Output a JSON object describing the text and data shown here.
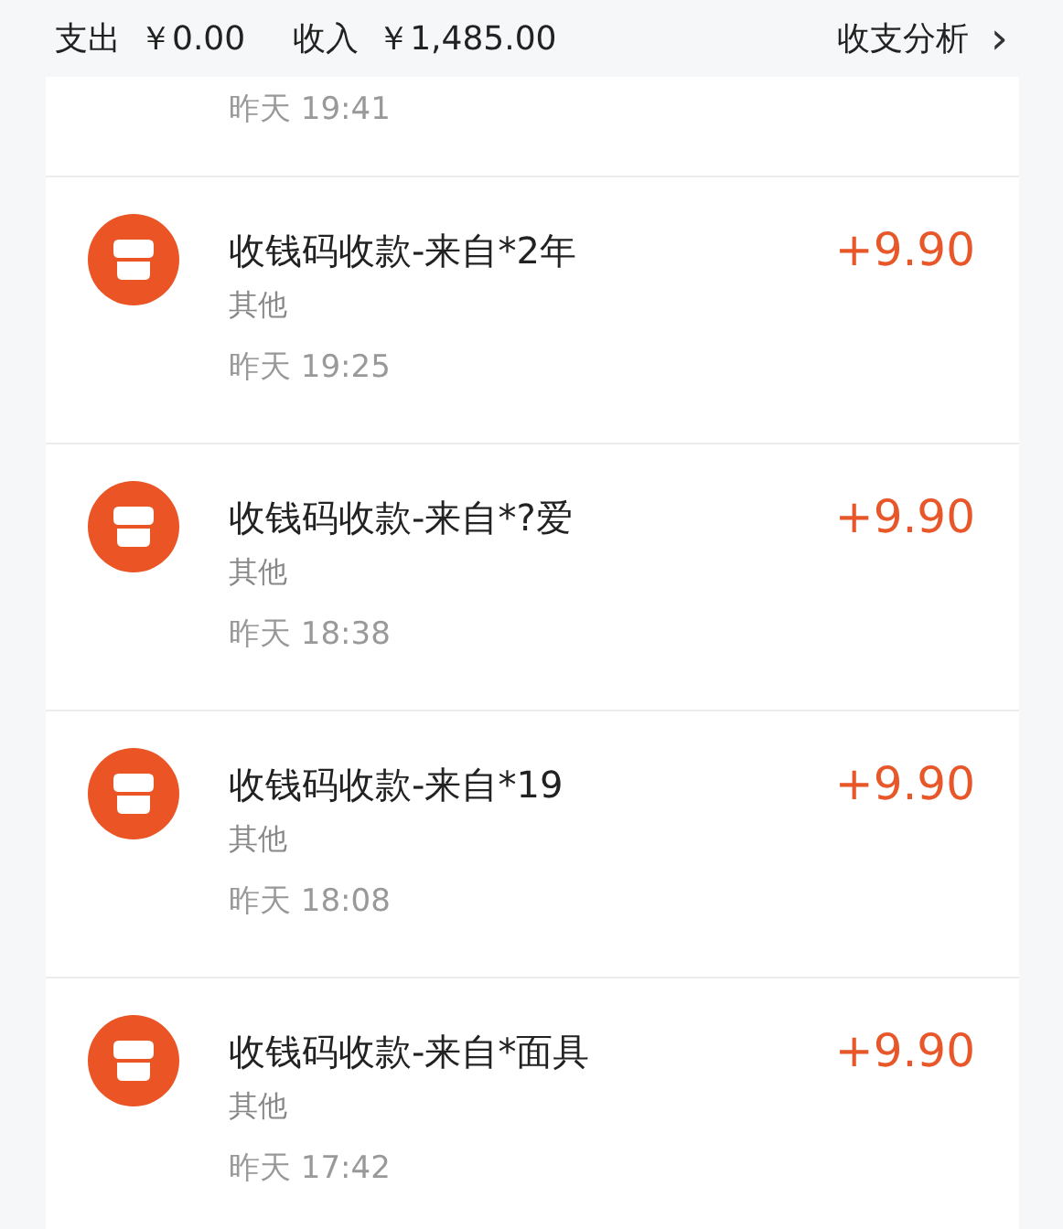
{
  "summary": {
    "expense_label": "支出",
    "expense": "￥0.00",
    "income_label": "收入",
    "income": "￥1,485.00",
    "analysis_link": "收支分析",
    "chevron": "›"
  },
  "partial_entry": {
    "time": "昨天 19:41"
  },
  "entries": [
    {
      "title": "收钱码收款-来自*2年",
      "category": "其他",
      "time": "昨天 19:25",
      "amount": "+9.90"
    },
    {
      "title": "收钱码收款-来自*?爱",
      "category": "其他",
      "time": "昨天 18:38",
      "amount": "+9.90"
    },
    {
      "title": "收钱码收款-来自*19",
      "category": "其他",
      "time": "昨天 18:08",
      "amount": "+9.90"
    },
    {
      "title": "收钱码收款-来自*面具",
      "category": "其他",
      "time": "昨天 17:42",
      "amount": "+9.90"
    }
  ]
}
